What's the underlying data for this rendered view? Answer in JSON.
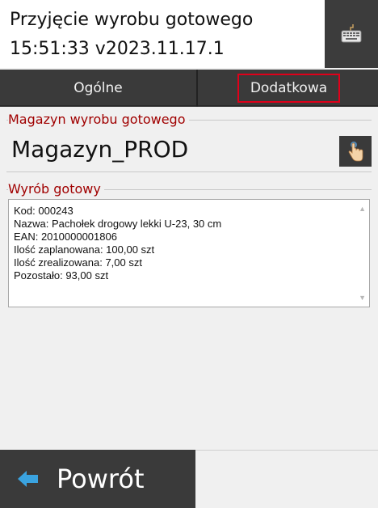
{
  "header": {
    "title": "Przyjęcie wyrobu gotowego",
    "time_version": "15:51:33   v2023.11.17.1",
    "keyboard_icon": "keyboard-icon"
  },
  "tabs": [
    {
      "label": "Ogólne"
    },
    {
      "label": "Dodatkowa",
      "highlighted": true
    }
  ],
  "magazyn": {
    "label": "Magazyn wyrobu gotowego",
    "value": "Magazyn_PROD",
    "button_icon": "pointing-hand-icon"
  },
  "wyrob": {
    "label": "Wyrób gotowy",
    "lines": [
      "Kod: 000243",
      "Nazwa: Pachołek drogowy lekki U-23, 30 cm",
      "EAN: 2010000001806",
      "Ilość zaplanowana: 100,00 szt",
      "Ilość zrealizowana: 7,00 szt",
      "Pozostało: 93,00 szt"
    ]
  },
  "footer": {
    "back_label": "Powrót",
    "back_icon": "left-arrow-icon"
  },
  "colors": {
    "dark": "#3a3a3a",
    "label_red": "#a00000",
    "highlight_red": "#e0001a",
    "arrow_blue": "#3aa3e0"
  }
}
